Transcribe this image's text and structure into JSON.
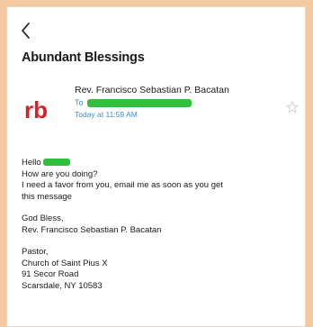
{
  "email": {
    "subject": "Abundant Blessings",
    "avatar_text": "rb",
    "sender_name": "Rev. Francisco Sebastian P. Bacatan",
    "to_label": "To",
    "timestamp": "Today at 11:59 AM",
    "greeting": "Hello",
    "body_lines": [
      "How are you doing?",
      "I need a favor from you, email me as soon as you get",
      "this message"
    ],
    "signoff": "God Bless,",
    "signature_name": "Rev. Francisco Sebastian P. Bacatan",
    "title": "Pastor,",
    "address_lines": [
      "Church of Saint Pius X",
      "91 Secor Road",
      "Scarsdale, NY 10583"
    ]
  },
  "colors": {
    "background_frame": "#f5c9a0",
    "avatar_red": "#d42027",
    "redaction_green": "#2fbf3a",
    "link_blue": "#3a8ecf"
  },
  "icons": {
    "back": "chevron-left-icon",
    "star": "star-icon"
  }
}
